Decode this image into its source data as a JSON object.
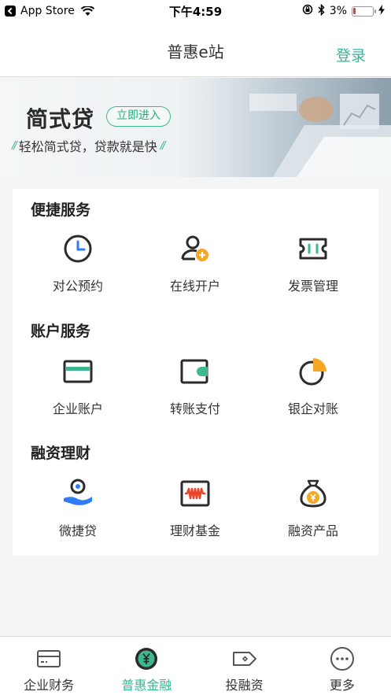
{
  "status_bar": {
    "carrier": "App Store",
    "time": "下午4:59",
    "battery": "3%"
  },
  "navbar": {
    "title": "普惠e站",
    "login": "登录"
  },
  "banner": {
    "title": "简式贷",
    "button": "立即进入",
    "subtitle": "轻松简式贷，贷款就是快",
    "accent_color": "#3fb88f"
  },
  "sections": [
    {
      "title": "便捷服务",
      "items": [
        {
          "label": "对公预约",
          "icon": "clock-icon"
        },
        {
          "label": "在线开户",
          "icon": "user-add-icon"
        },
        {
          "label": "发票管理",
          "icon": "invoice-icon"
        }
      ]
    },
    {
      "title": "账户服务",
      "items": [
        {
          "label": "企业账户",
          "icon": "card-icon"
        },
        {
          "label": "转账支付",
          "icon": "wallet-icon"
        },
        {
          "label": "银企对账",
          "icon": "pie-chart-icon"
        }
      ]
    },
    {
      "title": "融资理财",
      "items": [
        {
          "label": "微捷贷",
          "icon": "coin-hand-icon"
        },
        {
          "label": "理财基金",
          "icon": "chart-box-icon"
        },
        {
          "label": "融资产品",
          "icon": "money-bag-icon"
        }
      ]
    }
  ],
  "tabbar": {
    "items": [
      {
        "label": "企业财务",
        "icon": "card-icon"
      },
      {
        "label": "普惠金融",
        "icon": "yuan-icon"
      },
      {
        "label": "投融资",
        "icon": "tag-icon"
      },
      {
        "label": "更多",
        "icon": "more-icon"
      }
    ],
    "active_index": 1,
    "active_color": "#2eb89a"
  }
}
